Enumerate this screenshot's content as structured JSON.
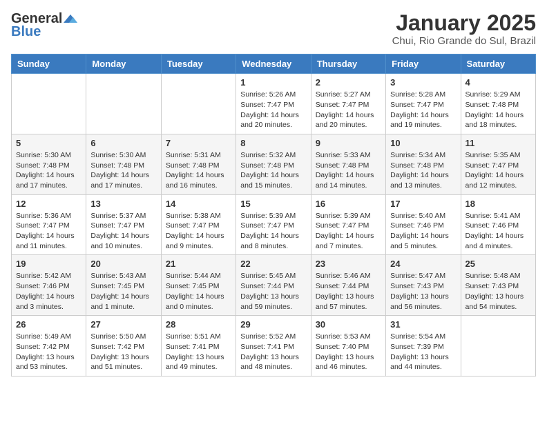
{
  "header": {
    "logo_general": "General",
    "logo_blue": "Blue",
    "month_title": "January 2025",
    "location": "Chui, Rio Grande do Sul, Brazil"
  },
  "days_of_week": [
    "Sunday",
    "Monday",
    "Tuesday",
    "Wednesday",
    "Thursday",
    "Friday",
    "Saturday"
  ],
  "weeks": [
    [
      {
        "day": "",
        "info": ""
      },
      {
        "day": "",
        "info": ""
      },
      {
        "day": "",
        "info": ""
      },
      {
        "day": "1",
        "info": "Sunrise: 5:26 AM\nSunset: 7:47 PM\nDaylight: 14 hours\nand 20 minutes."
      },
      {
        "day": "2",
        "info": "Sunrise: 5:27 AM\nSunset: 7:47 PM\nDaylight: 14 hours\nand 20 minutes."
      },
      {
        "day": "3",
        "info": "Sunrise: 5:28 AM\nSunset: 7:47 PM\nDaylight: 14 hours\nand 19 minutes."
      },
      {
        "day": "4",
        "info": "Sunrise: 5:29 AM\nSunset: 7:48 PM\nDaylight: 14 hours\nand 18 minutes."
      }
    ],
    [
      {
        "day": "5",
        "info": "Sunrise: 5:30 AM\nSunset: 7:48 PM\nDaylight: 14 hours\nand 17 minutes."
      },
      {
        "day": "6",
        "info": "Sunrise: 5:30 AM\nSunset: 7:48 PM\nDaylight: 14 hours\nand 17 minutes."
      },
      {
        "day": "7",
        "info": "Sunrise: 5:31 AM\nSunset: 7:48 PM\nDaylight: 14 hours\nand 16 minutes."
      },
      {
        "day": "8",
        "info": "Sunrise: 5:32 AM\nSunset: 7:48 PM\nDaylight: 14 hours\nand 15 minutes."
      },
      {
        "day": "9",
        "info": "Sunrise: 5:33 AM\nSunset: 7:48 PM\nDaylight: 14 hours\nand 14 minutes."
      },
      {
        "day": "10",
        "info": "Sunrise: 5:34 AM\nSunset: 7:48 PM\nDaylight: 14 hours\nand 13 minutes."
      },
      {
        "day": "11",
        "info": "Sunrise: 5:35 AM\nSunset: 7:47 PM\nDaylight: 14 hours\nand 12 minutes."
      }
    ],
    [
      {
        "day": "12",
        "info": "Sunrise: 5:36 AM\nSunset: 7:47 PM\nDaylight: 14 hours\nand 11 minutes."
      },
      {
        "day": "13",
        "info": "Sunrise: 5:37 AM\nSunset: 7:47 PM\nDaylight: 14 hours\nand 10 minutes."
      },
      {
        "day": "14",
        "info": "Sunrise: 5:38 AM\nSunset: 7:47 PM\nDaylight: 14 hours\nand 9 minutes."
      },
      {
        "day": "15",
        "info": "Sunrise: 5:39 AM\nSunset: 7:47 PM\nDaylight: 14 hours\nand 8 minutes."
      },
      {
        "day": "16",
        "info": "Sunrise: 5:39 AM\nSunset: 7:47 PM\nDaylight: 14 hours\nand 7 minutes."
      },
      {
        "day": "17",
        "info": "Sunrise: 5:40 AM\nSunset: 7:46 PM\nDaylight: 14 hours\nand 5 minutes."
      },
      {
        "day": "18",
        "info": "Sunrise: 5:41 AM\nSunset: 7:46 PM\nDaylight: 14 hours\nand 4 minutes."
      }
    ],
    [
      {
        "day": "19",
        "info": "Sunrise: 5:42 AM\nSunset: 7:46 PM\nDaylight: 14 hours\nand 3 minutes."
      },
      {
        "day": "20",
        "info": "Sunrise: 5:43 AM\nSunset: 7:45 PM\nDaylight: 14 hours\nand 1 minute."
      },
      {
        "day": "21",
        "info": "Sunrise: 5:44 AM\nSunset: 7:45 PM\nDaylight: 14 hours\nand 0 minutes."
      },
      {
        "day": "22",
        "info": "Sunrise: 5:45 AM\nSunset: 7:44 PM\nDaylight: 13 hours\nand 59 minutes."
      },
      {
        "day": "23",
        "info": "Sunrise: 5:46 AM\nSunset: 7:44 PM\nDaylight: 13 hours\nand 57 minutes."
      },
      {
        "day": "24",
        "info": "Sunrise: 5:47 AM\nSunset: 7:43 PM\nDaylight: 13 hours\nand 56 minutes."
      },
      {
        "day": "25",
        "info": "Sunrise: 5:48 AM\nSunset: 7:43 PM\nDaylight: 13 hours\nand 54 minutes."
      }
    ],
    [
      {
        "day": "26",
        "info": "Sunrise: 5:49 AM\nSunset: 7:42 PM\nDaylight: 13 hours\nand 53 minutes."
      },
      {
        "day": "27",
        "info": "Sunrise: 5:50 AM\nSunset: 7:42 PM\nDaylight: 13 hours\nand 51 minutes."
      },
      {
        "day": "28",
        "info": "Sunrise: 5:51 AM\nSunset: 7:41 PM\nDaylight: 13 hours\nand 49 minutes."
      },
      {
        "day": "29",
        "info": "Sunrise: 5:52 AM\nSunset: 7:41 PM\nDaylight: 13 hours\nand 48 minutes."
      },
      {
        "day": "30",
        "info": "Sunrise: 5:53 AM\nSunset: 7:40 PM\nDaylight: 13 hours\nand 46 minutes."
      },
      {
        "day": "31",
        "info": "Sunrise: 5:54 AM\nSunset: 7:39 PM\nDaylight: 13 hours\nand 44 minutes."
      },
      {
        "day": "",
        "info": ""
      }
    ]
  ]
}
